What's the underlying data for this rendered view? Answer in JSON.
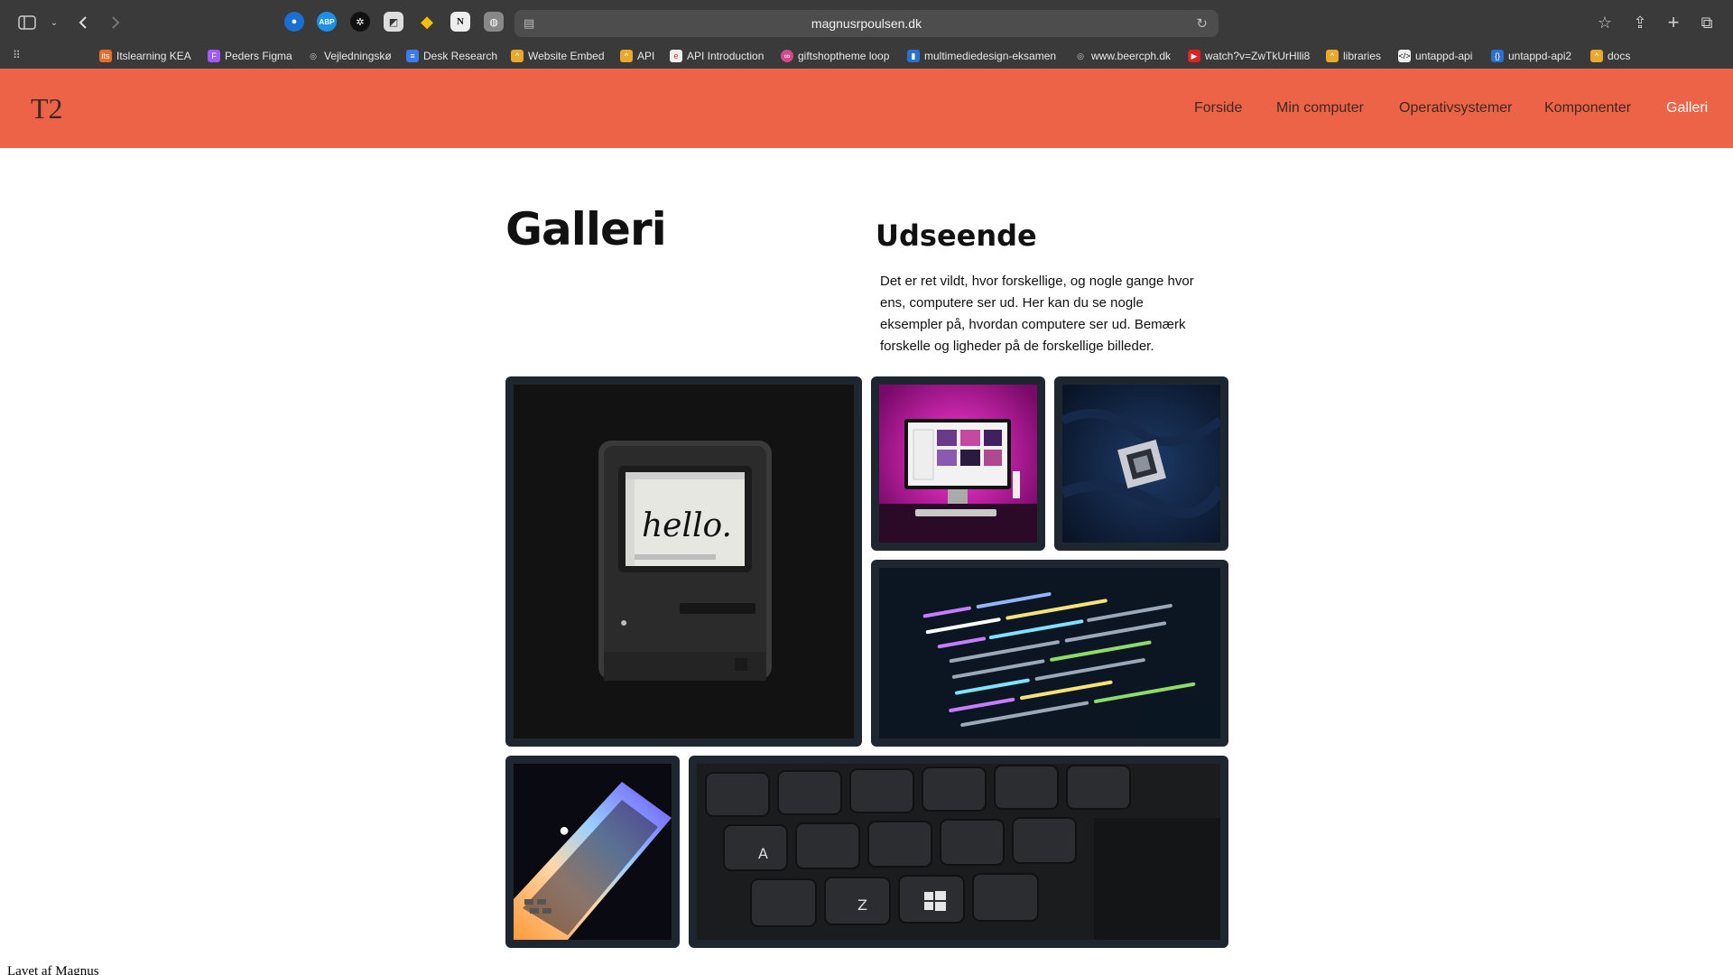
{
  "browser": {
    "url": "magnusrpoulsen.dk",
    "bookmarks": [
      "Itslearning KEA",
      "Peders Figma",
      "Vejledningskø",
      "Desk Research",
      "Website Embed",
      "API",
      "API Introduction",
      "giftshoptheme loop",
      "multimediedesign-eksamen",
      "www.beercph.dk",
      "watch?v=ZwTkUrHlli8",
      "libraries",
      "untappd-api",
      "untappd-api2",
      "docs"
    ]
  },
  "site": {
    "logo": "T2",
    "nav": [
      "Forside",
      "Min computer",
      "Operativsystemer",
      "Komponenter",
      "Galleri"
    ],
    "active_nav": "Galleri"
  },
  "main": {
    "title": "Galleri",
    "section_title": "Udseende",
    "intro": "Det er ret vildt, hvor forskellige, og nogle gange hvor ens, computere ser ud. Her kan du se nogle eksempler på, hvordan computere ser ud. Bemærk forskelle og ligheder på de forskellige billeder.",
    "hello_text": "hello."
  },
  "footer": {
    "credit": "Lavet af Magnus"
  },
  "colors": {
    "header_bg": "#ec6348",
    "tile_frame": "#1e2730",
    "nav_active": "#ffffff"
  }
}
